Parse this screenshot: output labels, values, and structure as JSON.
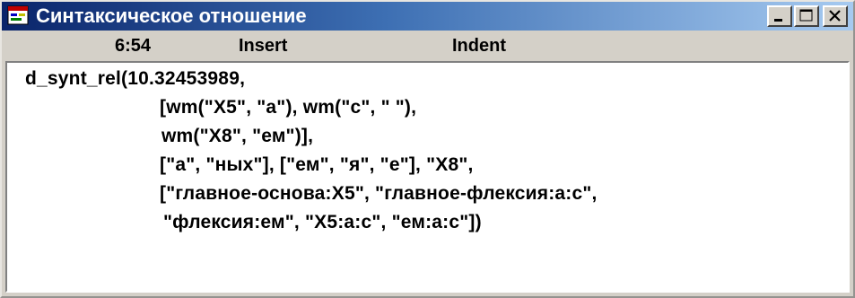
{
  "window": {
    "title": "Синтаксическое отношение",
    "icon": "app-window-icon"
  },
  "status": {
    "position": "6:54",
    "mode": "Insert",
    "indent": "Indent"
  },
  "code": {
    "lines": [
      "d_synt_rel(10.32453989,",
      "[wm(\"X5\", \"a\"), wm(\"c\", \" \"),",
      "wm(\"X8\", \"ем\")],",
      "[\"a\", \"ных\"], [\"ем\", \"я\", \"е\"], \"X8\",",
      "[\"главное-основа:X5\", \"главное-флексия:a:c\",",
      "\"флексия:ем\", \"X5:a:c\", \"ем:a:c\"])"
    ]
  },
  "colors": {
    "title_start": "#0a246a",
    "title_end": "#a6caf0",
    "face": "#d4d0c8"
  }
}
